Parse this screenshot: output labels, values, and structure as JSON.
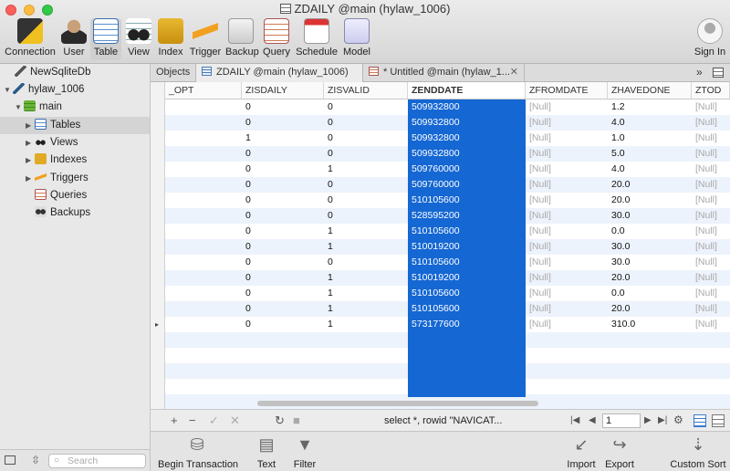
{
  "window": {
    "title": "ZDAILY @main (hylaw_1006)"
  },
  "toolbar": {
    "items": [
      "Connection",
      "User",
      "Table",
      "View",
      "Index",
      "Trigger",
      "Backup",
      "Query",
      "Schedule",
      "Model"
    ],
    "sign_in": "Sign In"
  },
  "tabs": {
    "objects": "Objects",
    "active": "ZDAILY @main (hylaw_1006)",
    "untitled": "* Untitled @main (hylaw_1...",
    "close": "✕",
    "more": "»"
  },
  "sidebar": {
    "connections": [
      "NewSqliteDb",
      "hylaw_1006"
    ],
    "database": "main",
    "nodes": [
      "Tables",
      "Views",
      "Indexes",
      "Triggers",
      "Queries",
      "Backups"
    ]
  },
  "grid": {
    "columns": [
      "_OPT",
      "ZISDAILY",
      "ZISVALID",
      "ZENDDATE",
      "ZFROMDATE",
      "ZHAVEDONE",
      "ZTOD"
    ],
    "rows": [
      [
        "0",
        "0",
        "509932800",
        "[Null]",
        "1.2",
        "[Null]"
      ],
      [
        "0",
        "0",
        "509932800",
        "[Null]",
        "4.0",
        "[Null]"
      ],
      [
        "1",
        "0",
        "509932800",
        "[Null]",
        "1.0",
        "[Null]"
      ],
      [
        "0",
        "0",
        "509932800",
        "[Null]",
        "5.0",
        "[Null]"
      ],
      [
        "0",
        "1",
        "509760000",
        "[Null]",
        "4.0",
        "[Null]"
      ],
      [
        "0",
        "0",
        "509760000",
        "[Null]",
        "20.0",
        "[Null]"
      ],
      [
        "0",
        "0",
        "510105600",
        "[Null]",
        "20.0",
        "[Null]"
      ],
      [
        "0",
        "0",
        "528595200",
        "[Null]",
        "30.0",
        "[Null]"
      ],
      [
        "0",
        "1",
        "510105600",
        "[Null]",
        "0.0",
        "[Null]"
      ],
      [
        "0",
        "1",
        "510019200",
        "[Null]",
        "30.0",
        "[Null]"
      ],
      [
        "0",
        "0",
        "510105600",
        "[Null]",
        "30.0",
        "[Null]"
      ],
      [
        "0",
        "1",
        "510019200",
        "[Null]",
        "20.0",
        "[Null]"
      ],
      [
        "0",
        "1",
        "510105600",
        "[Null]",
        "0.0",
        "[Null]"
      ],
      [
        "0",
        "1",
        "510105600",
        "[Null]",
        "20.0",
        "[Null]"
      ],
      [
        "0",
        "1",
        "573177600",
        "[Null]",
        "310.0",
        "[Null]"
      ]
    ],
    "current_row_marker": "▸"
  },
  "gridbar": {
    "sql": "select *, rowid \"NAVICAT...",
    "page": "1"
  },
  "bottom": {
    "left_tools": [
      "Begin Transaction",
      "Text",
      "Filter"
    ],
    "right_tools": [
      "Import",
      "Export",
      "Custom Sort"
    ]
  },
  "search": {
    "placeholder": "Search"
  },
  "colors": {
    "selection": "#1567d3",
    "null_text": "#a8a8a8",
    "alt_row": "#edf3fc"
  }
}
